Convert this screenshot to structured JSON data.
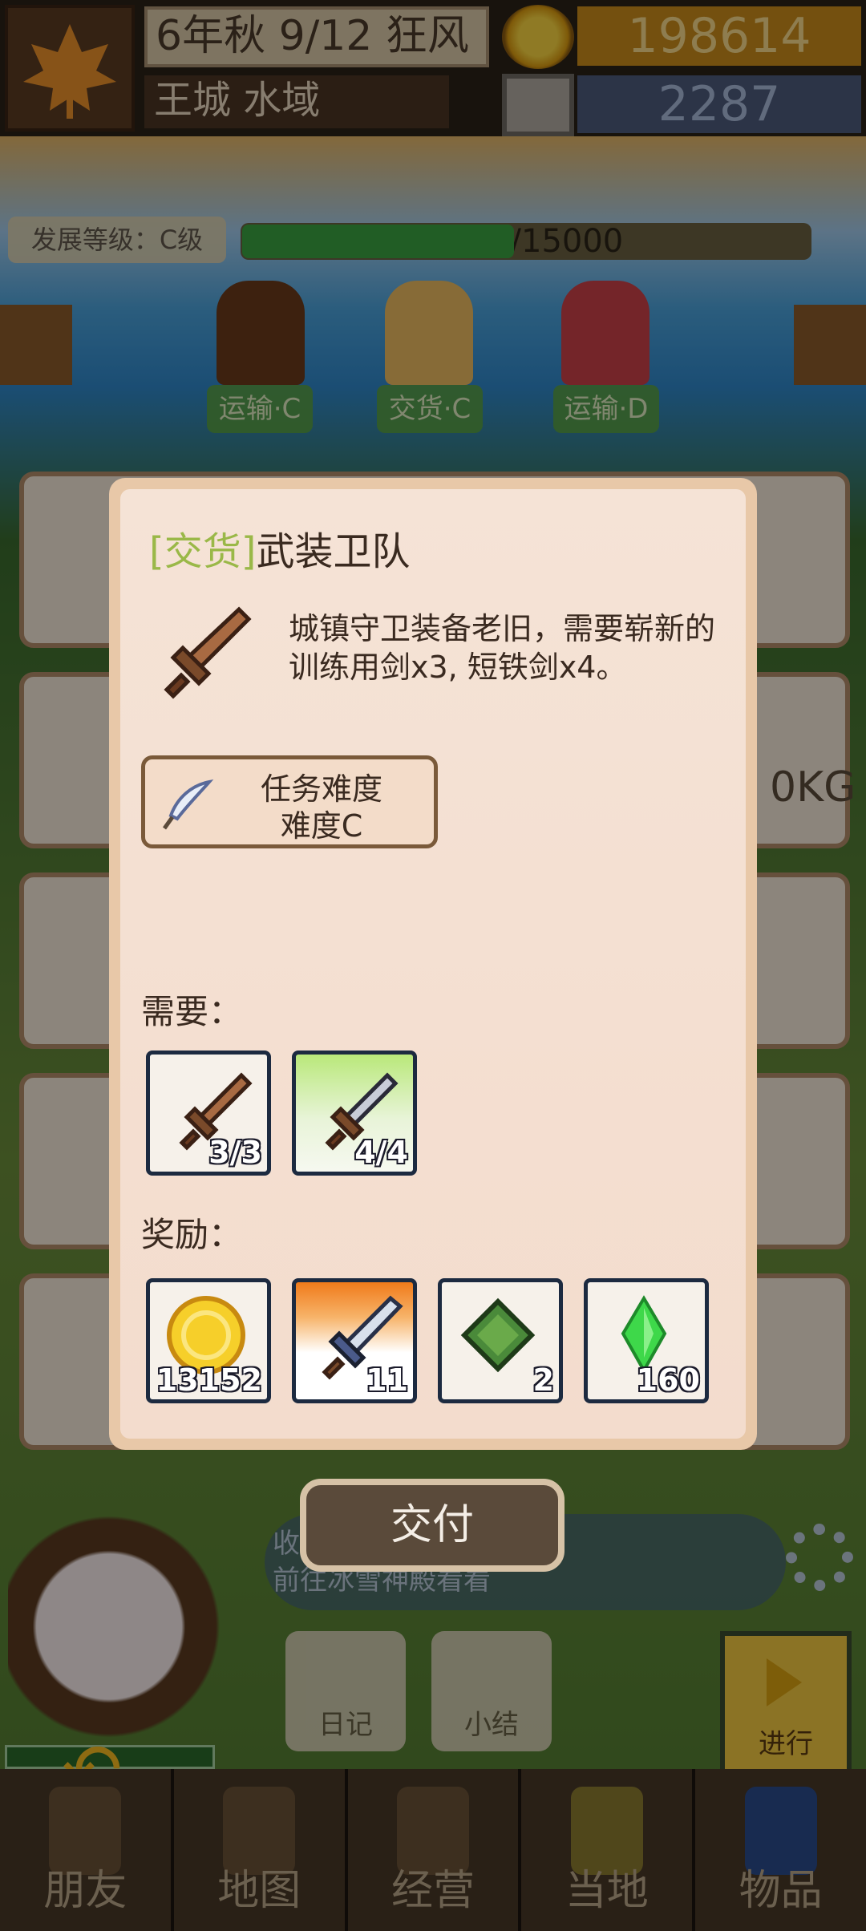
{
  "header": {
    "date": "6年秋 9/12 狂风",
    "location": "王城 水域",
    "gold": "198614",
    "gems": "2287"
  },
  "development": {
    "label": "发展等级：C级",
    "progress_text": "7187/15000",
    "progress": 0.479
  },
  "npc_tags": [
    "运输·C",
    "交货·C",
    "运输·D"
  ],
  "side_weight_text": "0KG",
  "message_lines": [
    "收",
    "前往冰雪神殿看看"
  ],
  "small_buttons": [
    "日记",
    "小结"
  ],
  "go_button": "进行",
  "nav": [
    "朋友",
    "地图",
    "经营",
    "当地",
    "物品"
  ],
  "quest": {
    "type": "[交货]",
    "title": "武装卫队",
    "description": "城镇守卫装备老旧，需要崭新的训练用剑x3, 短铁剑x4。",
    "difficulty_label": "任务难度",
    "difficulty_value": "难度C",
    "requirements_label": "需要：",
    "requirements": [
      {
        "icon": "training-sword-icon",
        "count": "3/3",
        "rarity_color": "#f6f1ea"
      },
      {
        "icon": "short-iron-sword-icon",
        "count": "4/4",
        "rarity_color": "#b9e87a"
      }
    ],
    "rewards_label": "奖励：",
    "rewards": [
      {
        "icon": "gold-coin-icon",
        "count": "13152"
      },
      {
        "icon": "steel-sword-icon",
        "count": "11",
        "rarity_color": "#f07a1a"
      },
      {
        "icon": "green-book-icon",
        "count": "2"
      },
      {
        "icon": "green-crystal-icon",
        "count": "160"
      }
    ],
    "deliver_button": "交付"
  }
}
